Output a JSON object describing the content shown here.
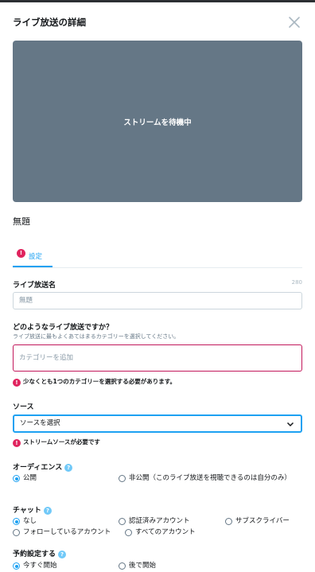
{
  "header": {
    "title": "ライブ放送の詳細",
    "close_icon": "close-icon"
  },
  "preview": {
    "status": "ストリームを待機中",
    "background": "#657786"
  },
  "broadcast_title": "無題",
  "tabs": [
    {
      "label": "設定",
      "badge": "!"
    }
  ],
  "broadcast_name": {
    "label": "ライブ放送名",
    "counter": "280",
    "placeholder": "無題"
  },
  "category": {
    "label": "どのようなライブ放送ですか？",
    "description": "ライブ放送に最もよくあてはまるカテゴリーを選択してください。",
    "placeholder": "カテゴリーを追加",
    "error": "少なくとも1つのカテゴリーを選択する必要があります。"
  },
  "source": {
    "label": "ソース",
    "selected": "ソースを選択",
    "error": "ストリームソースが必要です"
  },
  "audience": {
    "label": "オーディエンス",
    "help": "?",
    "options": [
      {
        "label": "公開",
        "selected": true
      },
      {
        "label": "非公開（このライブ放送を視聴できるのは自分のみ）",
        "selected": false
      }
    ]
  },
  "chat": {
    "label": "チャット",
    "help": "?",
    "options": [
      {
        "label": "なし",
        "selected": true
      },
      {
        "label": "認証済みアカウント",
        "selected": false
      },
      {
        "label": "サブスクライバー",
        "selected": false
      },
      {
        "label": "フォローしているアカウント",
        "selected": false
      },
      {
        "label": "すべてのアカウント",
        "selected": false
      }
    ]
  },
  "schedule": {
    "label": "予約設定する",
    "help": "?",
    "options": [
      {
        "label": "今すぐ開始",
        "selected": true
      },
      {
        "label": "後で開始",
        "selected": false
      }
    ]
  },
  "colors": {
    "accent": "#1da1f2",
    "error": "#e0245e",
    "help": "#71c9f8"
  }
}
